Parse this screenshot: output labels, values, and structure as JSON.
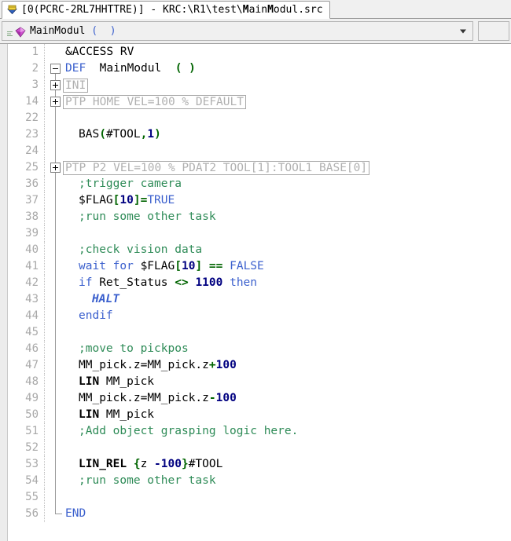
{
  "window": {
    "tab": {
      "icon": "import-icon",
      "text_plain_1": "[0(PCRC-2RL7HHTTRE)] - KRC:\\R1\\test\\",
      "text_bold": "M",
      "full_title": "[0(PCRC-2RL7HHTTRE)] - KRC:\\R1\\test\\MainModul.src"
    }
  },
  "modulebar": {
    "icon": "purple-diamond-icon",
    "lines_icon": "declaration-lines-icon",
    "name": "MainModul",
    "params": "(  )",
    "dropdown_icon": "chevron-down-icon"
  },
  "editor": {
    "colors": {
      "keyword": "#3a5fcd",
      "comment": "#2e8b57",
      "operator": "#006400",
      "number": "#000080",
      "text": "#000000",
      "collapsed": "#b0b0b0",
      "gutter": "#a9a9a9",
      "background": "#ffffff"
    },
    "lines": [
      {
        "num": "1",
        "fold": "none",
        "indent": 0,
        "tokens": [
          {
            "t": "&ACCESS RV",
            "c": "t-plain"
          }
        ]
      },
      {
        "num": "2",
        "fold": "minus-top",
        "indent": 0,
        "tokens": [
          {
            "t": "DEF",
            "c": "t-kw"
          },
          {
            "t": "  MainModul  ",
            "c": "t-plain"
          },
          {
            "t": "( )",
            "c": "t-op"
          }
        ]
      },
      {
        "num": "3",
        "fold": "plus",
        "indent": 0,
        "collapsed": "INI"
      },
      {
        "num": "14",
        "fold": "plus",
        "indent": 0,
        "collapsed": "PTP HOME VEL=100 % DEFAULT"
      },
      {
        "num": "22",
        "fold": "line",
        "indent": 0,
        "tokens": []
      },
      {
        "num": "23",
        "fold": "line",
        "indent": 1,
        "tokens": [
          {
            "t": "BAS",
            "c": "t-plain"
          },
          {
            "t": "(",
            "c": "t-op"
          },
          {
            "t": "#TOOL",
            "c": "t-plain"
          },
          {
            "t": ",",
            "c": "t-op"
          },
          {
            "t": "1",
            "c": "t-num"
          },
          {
            "t": ")",
            "c": "t-op"
          }
        ]
      },
      {
        "num": "24",
        "fold": "line",
        "indent": 0,
        "tokens": []
      },
      {
        "num": "25",
        "fold": "plus",
        "indent": 0,
        "collapsed": "PTP P2 VEL=100 % PDAT2 TOOL[1]:TOOL1 BASE[0]"
      },
      {
        "num": "36",
        "fold": "line",
        "indent": 1,
        "tokens": [
          {
            "t": ";trigger camera",
            "c": "t-cmt"
          }
        ]
      },
      {
        "num": "37",
        "fold": "line",
        "indent": 1,
        "tokens": [
          {
            "t": "$FLAG",
            "c": "t-plain"
          },
          {
            "t": "[",
            "c": "t-op"
          },
          {
            "t": "10",
            "c": "t-num"
          },
          {
            "t": "]",
            "c": "t-op"
          },
          {
            "t": "=",
            "c": "t-op"
          },
          {
            "t": "TRUE",
            "c": "t-kw"
          }
        ]
      },
      {
        "num": "38",
        "fold": "line",
        "indent": 1,
        "tokens": [
          {
            "t": ";run some other task",
            "c": "t-cmt"
          }
        ]
      },
      {
        "num": "39",
        "fold": "line",
        "indent": 0,
        "tokens": []
      },
      {
        "num": "40",
        "fold": "line",
        "indent": 1,
        "tokens": [
          {
            "t": ";check vision data",
            "c": "t-cmt"
          }
        ]
      },
      {
        "num": "41",
        "fold": "line",
        "indent": 1,
        "tokens": [
          {
            "t": "wait for ",
            "c": "t-kw"
          },
          {
            "t": "$FLAG",
            "c": "t-plain"
          },
          {
            "t": "[",
            "c": "t-op"
          },
          {
            "t": "10",
            "c": "t-num"
          },
          {
            "t": "]",
            "c": "t-op"
          },
          {
            "t": " ",
            "c": "t-plain"
          },
          {
            "t": "==",
            "c": "t-op"
          },
          {
            "t": " ",
            "c": "t-plain"
          },
          {
            "t": "FALSE",
            "c": "t-kw"
          }
        ]
      },
      {
        "num": "42",
        "fold": "line",
        "indent": 1,
        "tokens": [
          {
            "t": "if",
            "c": "t-kw"
          },
          {
            "t": " Ret_Status ",
            "c": "t-plain"
          },
          {
            "t": "<>",
            "c": "t-op"
          },
          {
            "t": " ",
            "c": "t-plain"
          },
          {
            "t": "1100",
            "c": "t-num"
          },
          {
            "t": " ",
            "c": "t-plain"
          },
          {
            "t": "then",
            "c": "t-kw"
          }
        ]
      },
      {
        "num": "43",
        "fold": "line",
        "indent": 2,
        "tokens": [
          {
            "t": "HALT",
            "c": "t-kw-b"
          }
        ]
      },
      {
        "num": "44",
        "fold": "line",
        "indent": 1,
        "tokens": [
          {
            "t": "endif",
            "c": "t-kw"
          }
        ]
      },
      {
        "num": "45",
        "fold": "line",
        "indent": 0,
        "tokens": []
      },
      {
        "num": "46",
        "fold": "line",
        "indent": 1,
        "tokens": [
          {
            "t": ";move to pickpos",
            "c": "t-cmt"
          }
        ]
      },
      {
        "num": "47",
        "fold": "line",
        "indent": 1,
        "tokens": [
          {
            "t": "MM_pick.z",
            "c": "t-plain"
          },
          {
            "t": "=",
            "c": "t-plain"
          },
          {
            "t": "MM_pick.z",
            "c": "t-plain"
          },
          {
            "t": "+",
            "c": "t-op"
          },
          {
            "t": "100",
            "c": "t-num"
          }
        ]
      },
      {
        "num": "48",
        "fold": "line",
        "indent": 1,
        "tokens": [
          {
            "t": "LIN",
            "c": "t-bold"
          },
          {
            "t": " MM_pick",
            "c": "t-plain"
          }
        ]
      },
      {
        "num": "49",
        "fold": "line",
        "indent": 1,
        "tokens": [
          {
            "t": "MM_pick.z",
            "c": "t-plain"
          },
          {
            "t": "=",
            "c": "t-plain"
          },
          {
            "t": "MM_pick.z",
            "c": "t-plain"
          },
          {
            "t": "-",
            "c": "t-op"
          },
          {
            "t": "100",
            "c": "t-num"
          }
        ]
      },
      {
        "num": "50",
        "fold": "line",
        "indent": 1,
        "tokens": [
          {
            "t": "LIN",
            "c": "t-bold"
          },
          {
            "t": " MM_pick",
            "c": "t-plain"
          }
        ]
      },
      {
        "num": "51",
        "fold": "line",
        "indent": 1,
        "tokens": [
          {
            "t": ";Add object grasping logic here.",
            "c": "t-cmt"
          }
        ]
      },
      {
        "num": "52",
        "fold": "line",
        "indent": 0,
        "tokens": []
      },
      {
        "num": "53",
        "fold": "line",
        "indent": 1,
        "tokens": [
          {
            "t": "LIN_REL",
            "c": "t-bold"
          },
          {
            "t": " ",
            "c": "t-plain"
          },
          {
            "t": "{",
            "c": "t-op"
          },
          {
            "t": "z ",
            "c": "t-plain"
          },
          {
            "t": "-100",
            "c": "t-num"
          },
          {
            "t": "}",
            "c": "t-op"
          },
          {
            "t": "#TOOL",
            "c": "t-plain"
          }
        ]
      },
      {
        "num": "54",
        "fold": "line",
        "indent": 1,
        "tokens": [
          {
            "t": ";run some other task",
            "c": "t-cmt"
          }
        ]
      },
      {
        "num": "55",
        "fold": "line",
        "indent": 0,
        "tokens": []
      },
      {
        "num": "56",
        "fold": "end",
        "indent": 0,
        "tokens": [
          {
            "t": "END",
            "c": "t-kw"
          }
        ]
      }
    ]
  }
}
